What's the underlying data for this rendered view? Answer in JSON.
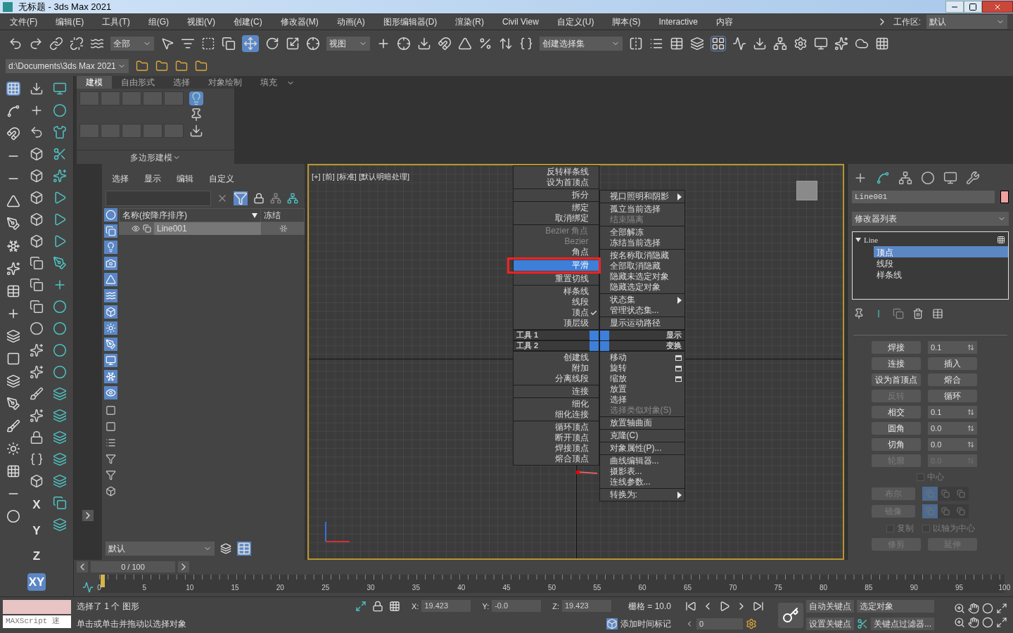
{
  "window": {
    "title": "无标题 - 3ds Max 2021"
  },
  "menu_bar": [
    "文件(F)",
    "编辑(E)",
    "工具(T)",
    "组(G)",
    "视图(V)",
    "创建(C)",
    "修改器(M)",
    "动画(A)",
    "图形编辑器(D)",
    "渲染(R)",
    "Civil View",
    "自定义(U)",
    "脚本(S)",
    "Interactive",
    "内容"
  ],
  "workspace": {
    "label": "工作区:",
    "value": "默认"
  },
  "main_toolbar": {
    "selection_filter": "全部",
    "reference_coordinate": "视图",
    "named_selection_set": "创建选择集"
  },
  "project_toolbar": {
    "path": "d:\\Documents\\3ds Max 2021"
  },
  "ribbon": {
    "tabs": [
      {
        "label": "建模",
        "selected": true
      },
      {
        "label": "自由形式",
        "selected": false
      },
      {
        "label": "选择",
        "selected": false
      },
      {
        "label": "对象绘制",
        "selected": false
      },
      {
        "label": "填充",
        "selected": false
      }
    ],
    "panel_title": "多边形建模"
  },
  "axis_constraints": [
    {
      "label": "X",
      "selected": false
    },
    {
      "label": "Y",
      "selected": false
    },
    {
      "label": "Z",
      "selected": false
    },
    {
      "label": "XY",
      "selected": true
    }
  ],
  "scene_explorer": {
    "tabs": [
      "选择",
      "显示",
      "编辑",
      "自定义"
    ],
    "columns": [
      "名称(按降序排序)",
      "冻结"
    ],
    "rows": [
      {
        "name": "Line001",
        "selected": true
      }
    ],
    "layer": "默认"
  },
  "viewport": {
    "label": "[+] [前] [标准] [默认明暗处理]"
  },
  "quad_menu": {
    "top_left": [
      [
        {
          "label": "反转样条线",
          "disabled": false,
          "selected": false,
          "checked": false
        },
        {
          "label": "设为首顶点",
          "disabled": false,
          "selected": false,
          "checked": false
        }
      ],
      [
        {
          "label": "拆分",
          "disabled": false,
          "selected": false,
          "checked": false
        }
      ],
      [
        {
          "label": "绑定",
          "disabled": false,
          "selected": false,
          "checked": false
        },
        {
          "label": "取消绑定",
          "disabled": false,
          "selected": false,
          "checked": false
        }
      ],
      [
        {
          "label": "Bezier 角点",
          "disabled": true,
          "selected": false,
          "checked": false
        },
        {
          "label": "Bezier",
          "disabled": true,
          "selected": false,
          "checked": false
        },
        {
          "label": "角点",
          "disabled": false,
          "selected": false,
          "checked": false
        },
        {
          "label": "平滑",
          "disabled": false,
          "selected": true,
          "checked": false
        },
        {
          "label": "重置切线",
          "disabled": false,
          "selected": false,
          "checked": false
        }
      ],
      [
        {
          "label": "样条线",
          "disabled": false,
          "selected": false,
          "checked": false
        },
        {
          "label": "线段",
          "disabled": false,
          "selected": false,
          "checked": false
        },
        {
          "label": "顶点",
          "disabled": false,
          "selected": false,
          "checked": true
        },
        {
          "label": "顶层级",
          "disabled": false,
          "selected": false,
          "checked": false
        }
      ]
    ],
    "top_right": [
      [
        {
          "label": "视口照明和阴影",
          "kind": "submenu",
          "disabled": false
        }
      ],
      [
        {
          "label": "孤立当前选择",
          "kind": "plain",
          "disabled": false
        },
        {
          "label": "结束隔离",
          "kind": "plain",
          "disabled": true
        }
      ],
      [
        {
          "label": "全部解冻",
          "kind": "plain",
          "disabled": false
        },
        {
          "label": "冻结当前选择",
          "kind": "plain",
          "disabled": false
        }
      ],
      [
        {
          "label": "按名称取消隐藏",
          "kind": "plain",
          "disabled": false
        },
        {
          "label": "全部取消隐藏",
          "kind": "plain",
          "disabled": false
        },
        {
          "label": "隐藏未选定对象",
          "kind": "plain",
          "disabled": false
        },
        {
          "label": "隐藏选定对象",
          "kind": "plain",
          "disabled": false
        }
      ],
      [
        {
          "label": "状态集",
          "kind": "submenu",
          "disabled": false
        },
        {
          "label": "管理状态集...",
          "kind": "plain",
          "disabled": false
        }
      ],
      [
        {
          "label": "显示运动路径",
          "kind": "plain",
          "disabled": false
        }
      ]
    ],
    "tool_bars": [
      {
        "left": "工具 1",
        "right": "显示"
      },
      {
        "left": "工具 2",
        "right": "变换"
      }
    ],
    "bottom_left": [
      [
        "创建线",
        "附加",
        "分离线段"
      ],
      [
        "连接"
      ],
      [
        "细化",
        "细化连接"
      ],
      [
        "循环顶点",
        "断开顶点",
        "焊接顶点",
        "熔合顶点"
      ]
    ],
    "bottom_right": [
      [
        {
          "label": "移动",
          "kind": "option",
          "disabled": false
        },
        {
          "label": "旋转",
          "kind": "option",
          "disabled": false
        },
        {
          "label": "缩放",
          "kind": "option",
          "disabled": false
        },
        {
          "label": "放置",
          "kind": "plain",
          "disabled": false
        },
        {
          "label": "选择",
          "kind": "plain",
          "disabled": false
        },
        {
          "label": "选择类似对象(S)",
          "kind": "plain",
          "disabled": true
        }
      ],
      [
        {
          "label": "放置轴曲面",
          "kind": "plain",
          "disabled": false
        }
      ],
      [
        {
          "label": "克隆(C)",
          "kind": "plain",
          "disabled": false
        }
      ],
      [
        {
          "label": "对象属性(P)...",
          "kind": "plain",
          "disabled": false
        }
      ],
      [
        {
          "label": "曲线编辑器...",
          "kind": "plain",
          "disabled": false
        },
        {
          "label": "摄影表...",
          "kind": "plain",
          "disabled": false
        },
        {
          "label": "连线参数...",
          "kind": "plain",
          "disabled": false
        }
      ],
      [
        {
          "label": "转换为:",
          "kind": "submenu",
          "disabled": false
        }
      ]
    ]
  },
  "command_panel": {
    "object_name": "Line001",
    "modifier_list": "修改器列表",
    "stack": [
      {
        "label": "Line",
        "expanded": true,
        "children": [
          {
            "label": "顶点",
            "selected": true
          },
          {
            "label": "线段",
            "selected": false
          },
          {
            "label": "样条线",
            "selected": false
          }
        ]
      }
    ],
    "rollout": [
      {
        "kind": "button_spinner",
        "button": {
          "label": "焊接",
          "disabled": false
        },
        "value": "0.1"
      },
      {
        "kind": "button_pair",
        "buttons": [
          {
            "label": "连接",
            "disabled": false
          },
          {
            "label": "插入",
            "disabled": false
          }
        ]
      },
      {
        "kind": "button_pair",
        "buttons": [
          {
            "label": "设为首顶点",
            "disabled": false
          },
          {
            "label": "熔合",
            "disabled": false
          }
        ]
      },
      {
        "kind": "button_pair",
        "buttons": [
          {
            "label": "反转",
            "disabled": true
          },
          {
            "label": "循环",
            "disabled": false
          }
        ]
      },
      {
        "kind": "button_spinner",
        "button": {
          "label": "相交",
          "disabled": false
        },
        "value": "0.1"
      },
      {
        "kind": "button_spinner",
        "button": {
          "label": "圆角",
          "disabled": false
        },
        "value": "0.0"
      },
      {
        "kind": "button_spinner",
        "button": {
          "label": "切角",
          "disabled": false
        },
        "value": "0.0"
      },
      {
        "kind": "button_spinner",
        "button": {
          "label": "轮廓",
          "disabled": true
        },
        "value": "0.0"
      },
      {
        "kind": "checkboxes",
        "items": [
          {
            "label": "中心",
            "checked": false,
            "disabled": true
          }
        ]
      },
      {
        "kind": "button_icons",
        "button": {
          "label": "布尔",
          "disabled": true
        },
        "options": [
          {
            "selected": true
          },
          {
            "selected": false
          },
          {
            "selected": false
          }
        ]
      },
      {
        "kind": "button_icons",
        "button": {
          "label": "镜像",
          "disabled": true
        },
        "options": [
          {
            "selected": true
          },
          {
            "selected": false
          },
          {
            "selected": false
          }
        ]
      },
      {
        "kind": "checkboxes",
        "items": [
          {
            "label": "复制",
            "checked": false,
            "disabled": true
          },
          {
            "label": "以轴为中心",
            "checked": false,
            "disabled": true
          }
        ]
      },
      {
        "kind": "button_pair",
        "buttons": [
          {
            "label": "修剪",
            "disabled": true
          },
          {
            "label": "延伸",
            "disabled": true
          }
        ]
      }
    ]
  },
  "time_slider": {
    "label": "0 / 100"
  },
  "timeline": {
    "ticks": [
      "0",
      "5",
      "10",
      "15",
      "20",
      "25",
      "30",
      "35",
      "40",
      "45",
      "50",
      "55",
      "60",
      "65",
      "70",
      "75",
      "80",
      "85",
      "90",
      "95",
      "100"
    ]
  },
  "status": {
    "maxscript": "MAXScript 迷",
    "selection": "选择了 1 个 图形",
    "prompt": "单击或单击并拖动以选择对象",
    "coordinates": [
      {
        "label": "X:",
        "value": "19.423"
      },
      {
        "label": "Y:",
        "value": "-0.0"
      },
      {
        "label": "Z:",
        "value": "19.423"
      }
    ],
    "grid": "栅格 = 10.0",
    "add_time_tag": "添加时间标记",
    "frame": "0",
    "auto_key": "自动关键点",
    "key_mode": "选定对象",
    "set_key": "设置关键点",
    "key_filters": "关键点过滤器..."
  }
}
